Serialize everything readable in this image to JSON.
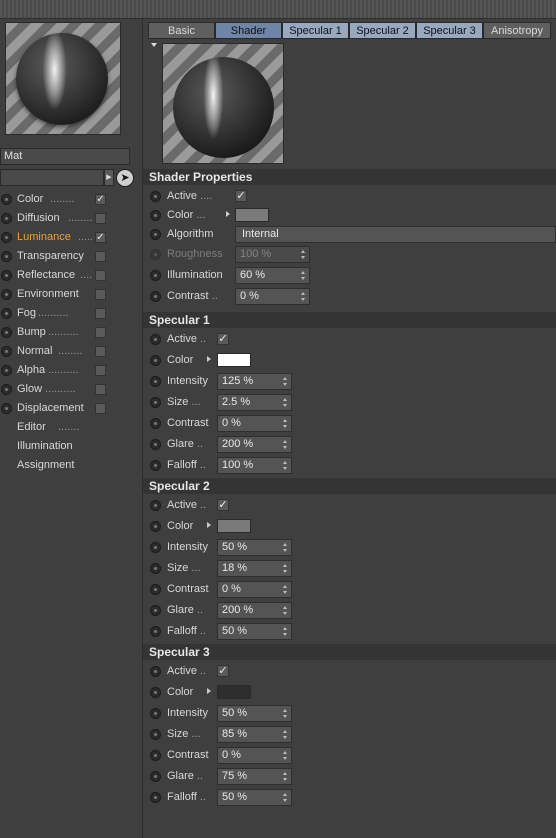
{
  "material_name": "Mat",
  "channels": [
    {
      "label": "Color",
      "dots": "........",
      "checked": true,
      "active": false
    },
    {
      "label": "Diffusion",
      "dots": "........",
      "checked": false,
      "active": false
    },
    {
      "label": "Luminance",
      "dots": "........",
      "checked": true,
      "active": true
    },
    {
      "label": "Transparency",
      "dots": "",
      "checked": false,
      "active": false
    },
    {
      "label": "Reflectance",
      "dots": "....",
      "checked": false,
      "active": false
    },
    {
      "label": "Environment",
      "dots": "",
      "checked": false,
      "active": false
    },
    {
      "label": "Fog",
      "dots": "..........",
      "checked": false,
      "active": false
    },
    {
      "label": "Bump",
      "dots": "..........",
      "checked": false,
      "active": false
    },
    {
      "label": "Normal",
      "dots": "........",
      "checked": false,
      "active": false
    },
    {
      "label": "Alpha",
      "dots": "..........",
      "checked": false,
      "active": false
    },
    {
      "label": "Glow",
      "dots": "..........",
      "checked": false,
      "active": false
    },
    {
      "label": "Displacement",
      "dots": "",
      "checked": false,
      "active": false
    }
  ],
  "extra_items": [
    "Editor",
    "Illumination",
    "Assignment"
  ],
  "extra_dots": ".......",
  "tabs": [
    "Basic",
    "Shader",
    "Specular 1",
    "Specular 2",
    "Specular 3",
    "Anisotropy"
  ],
  "shader": {
    "title": "Shader Properties",
    "active_label": "Active",
    "active_dots": "....",
    "color_label": "Color",
    "color_dots": "...",
    "algorithm_label": "Algorithm",
    "algorithm_value": "Internal",
    "roughness_label": "Roughness",
    "roughness_value": "100 %",
    "illumination_label": "Illumination",
    "illumination_value": "60 %",
    "contrast_label": "Contrast",
    "contrast_dots": "..",
    "contrast_value": "0 %"
  },
  "colors": {
    "shader_color": "#7a7a7a",
    "spec1_color": "#ffffff",
    "spec2_color": "#7a7a7a",
    "spec3_color": "#2e2e2e"
  },
  "specular": [
    {
      "title": "Specular 1",
      "active": "Active",
      "active_dots": "..",
      "color": "Color",
      "intensity": "Intensity",
      "intensity_value": "125 %",
      "size": "Size",
      "size_dots": "...",
      "size_value": "2.5 %",
      "contrast": "Contrast",
      "contrast_value": "0 %",
      "glare": "Glare",
      "glare_dots": "..",
      "glare_value": "200 %",
      "falloff": "Falloff",
      "falloff_dots": "..",
      "falloff_value": "100 %"
    },
    {
      "title": "Specular 2",
      "active": "Active",
      "active_dots": "..",
      "color": "Color",
      "intensity": "Intensity",
      "intensity_value": "50 %",
      "size": "Size",
      "size_dots": "...",
      "size_value": "18 %",
      "contrast": "Contrast",
      "contrast_value": "0 %",
      "glare": "Glare",
      "glare_dots": "..",
      "glare_value": "200 %",
      "falloff": "Falloff",
      "falloff_dots": "..",
      "falloff_value": "50 %"
    },
    {
      "title": "Specular 3",
      "active": "Active",
      "active_dots": "..",
      "color": "Color",
      "intensity": "Intensity",
      "intensity_value": "50 %",
      "size": "Size",
      "size_dots": "...",
      "size_value": "85 %",
      "contrast": "Contrast",
      "contrast_value": "0 %",
      "glare": "Glare",
      "glare_dots": "..",
      "glare_value": "75 %",
      "falloff": "Falloff",
      "falloff_dots": "..",
      "falloff_value": "50 %"
    }
  ]
}
